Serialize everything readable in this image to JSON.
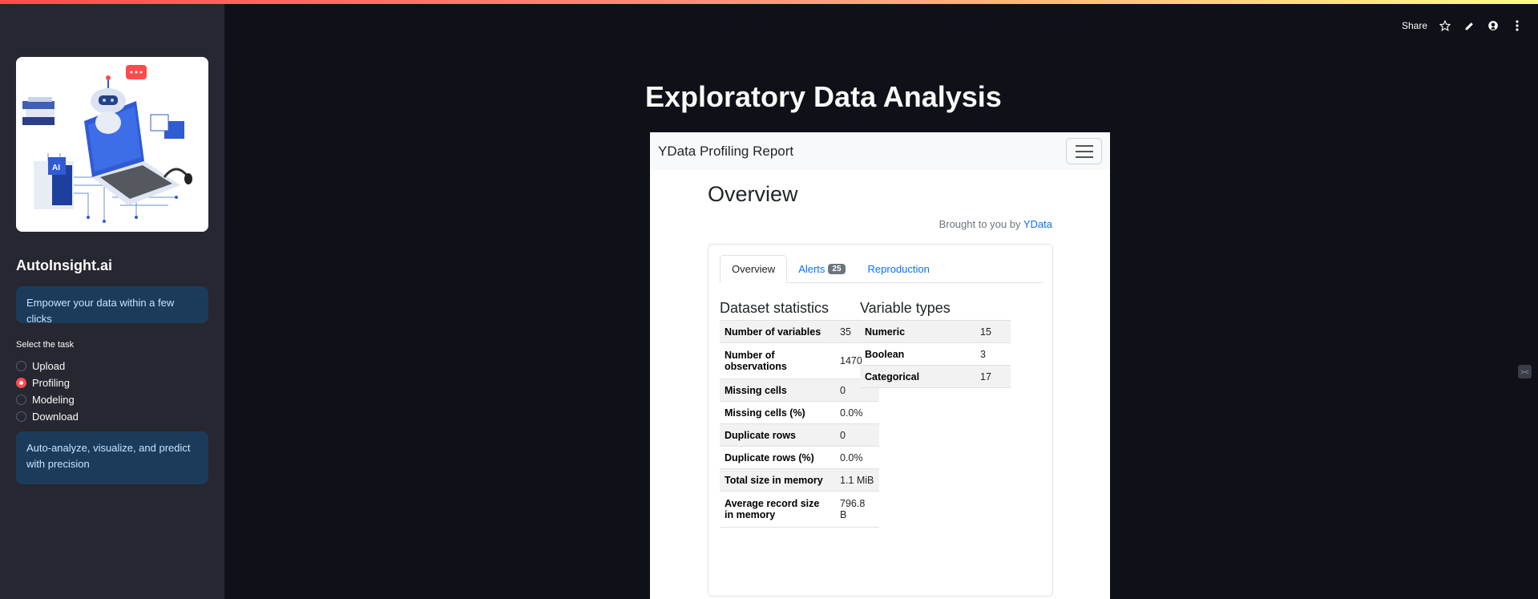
{
  "sidebar": {
    "app_name": "AutoInsight.ai",
    "tagline": "Empower your data within a few clicks",
    "task_label": "Select the task",
    "tasks": [
      {
        "label": "Upload",
        "selected": false
      },
      {
        "label": "Profiling",
        "selected": true
      },
      {
        "label": "Modeling",
        "selected": false
      },
      {
        "label": "Download",
        "selected": false
      }
    ],
    "description": "Auto-analyze, visualize, and predict with precision",
    "hero_image": "ai-laptop-illustration"
  },
  "header": {
    "share_label": "Share",
    "icons": [
      "star-icon",
      "edit-icon",
      "github-icon",
      "more-vert-icon"
    ]
  },
  "main": {
    "title": "Exploratory Data Analysis"
  },
  "report": {
    "brand": "YData Profiling Report",
    "section_title": "Overview",
    "brought_prefix": "Brought to you by",
    "brought_link": "YData",
    "tabs": [
      {
        "label": "Overview",
        "active": true
      },
      {
        "label": "Alerts",
        "badge": "25",
        "active": false
      },
      {
        "label": "Reproduction",
        "active": false
      }
    ],
    "dataset_statistics": {
      "title": "Dataset statistics",
      "rows": [
        {
          "key": "Number of variables",
          "value": "35"
        },
        {
          "key": "Number of observations",
          "value": "1470"
        },
        {
          "key": "Missing cells",
          "value": "0"
        },
        {
          "key": "Missing cells (%)",
          "value": "0.0%"
        },
        {
          "key": "Duplicate rows",
          "value": "0"
        },
        {
          "key": "Duplicate rows (%)",
          "value": "0.0%"
        },
        {
          "key": "Total size in memory",
          "value": "1.1 MiB"
        },
        {
          "key": "Average record size in memory",
          "value": "796.8 B"
        }
      ]
    },
    "variable_types": {
      "title": "Variable types",
      "rows": [
        {
          "key": "Numeric",
          "value": "15"
        },
        {
          "key": "Boolean",
          "value": "3"
        },
        {
          "key": "Categorical",
          "value": "17"
        }
      ]
    }
  },
  "colors": {
    "background": "#0e1117",
    "sidebar": "#262730",
    "accent": "#ff4b4b",
    "info_box": "#1c3b5a",
    "link": "#0d6efd"
  }
}
